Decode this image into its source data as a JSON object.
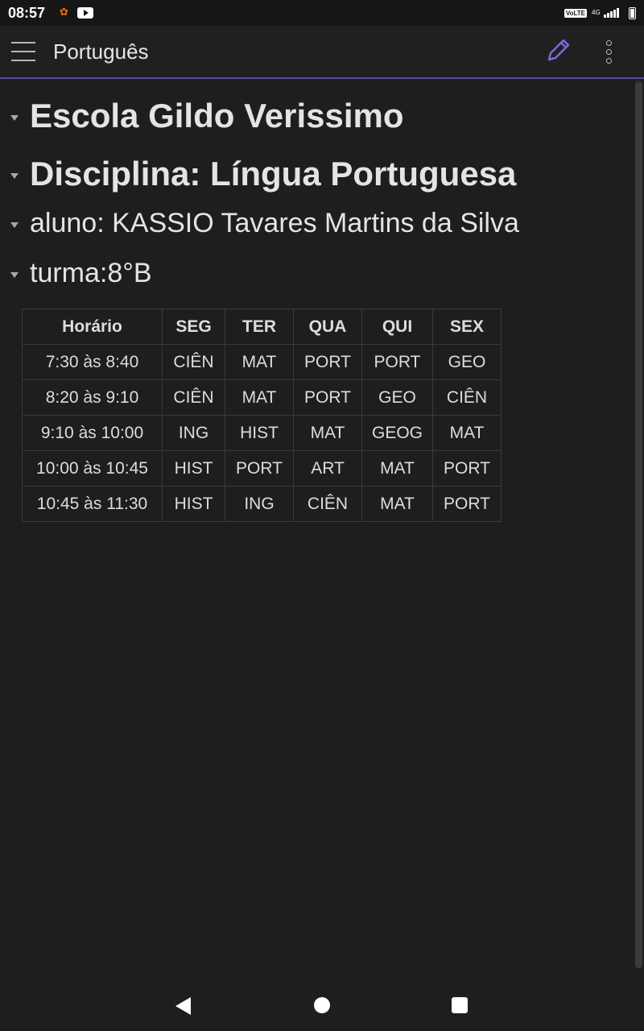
{
  "status_bar": {
    "time": "08:57",
    "volte": "VoLTE",
    "network": "4G"
  },
  "app_bar": {
    "title": "Português"
  },
  "note": {
    "heading1": "Escola Gildo Verissimo",
    "heading2": "Disciplina: Língua Portuguesa",
    "heading3": "aluno: KASSIO Tavares Martins da Silva",
    "heading4": "turma:8°B"
  },
  "schedule": {
    "headers": [
      "Horário",
      "SEG",
      "TER",
      "QUA",
      "QUI",
      "SEX"
    ],
    "rows": [
      [
        "7:30 às 8:40",
        "CIÊN",
        "MAT",
        "PORT",
        "PORT",
        "GEO"
      ],
      [
        "8:20 às 9:10",
        "CIÊN",
        "MAT",
        "PORT",
        "GEO",
        "CIÊN"
      ],
      [
        "9:10 às 10:00",
        "ING",
        "HIST",
        "MAT",
        "GEOG",
        "MAT"
      ],
      [
        "10:00 às 10:45",
        "HIST",
        "PORT",
        "ART",
        "MAT",
        "PORT"
      ],
      [
        "10:45 às 11:30",
        "HIST",
        "ING",
        "CIÊN",
        "MAT",
        "PORT"
      ]
    ]
  },
  "icons": {
    "menu": "hamburger-menu-icon",
    "edit": "pencil-icon",
    "more": "more-vertical-icon"
  },
  "colors": {
    "accent": "#7b6cd9",
    "background": "#1e1e1e",
    "text": "#dcddde"
  }
}
